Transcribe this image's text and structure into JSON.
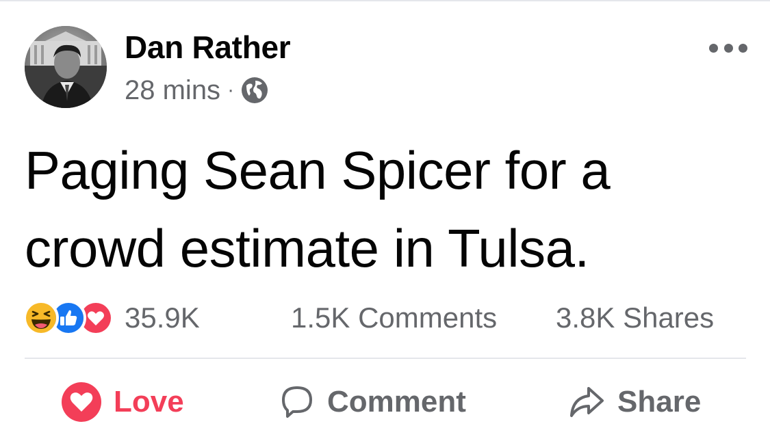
{
  "post": {
    "author_name": "Dan Rather",
    "timestamp": "28 mins",
    "separator": "·",
    "privacy_icon": "globe-icon",
    "text": "Paging Sean Spicer for a crowd estimate in Tulsa."
  },
  "stats": {
    "reaction_icons": [
      "haha-icon",
      "like-icon",
      "love-icon"
    ],
    "reaction_count": "35.9K",
    "comments": "1.5K Comments",
    "shares": "3.8K Shares"
  },
  "actions": {
    "love_label": "Love",
    "comment_label": "Comment",
    "share_label": "Share"
  },
  "colors": {
    "love_red": "#f33e58",
    "like_blue": "#1877f2",
    "haha_yellow": "#f7b928",
    "meta_gray": "#65676b",
    "text_black": "#050505",
    "divider": "#e4e6eb"
  }
}
